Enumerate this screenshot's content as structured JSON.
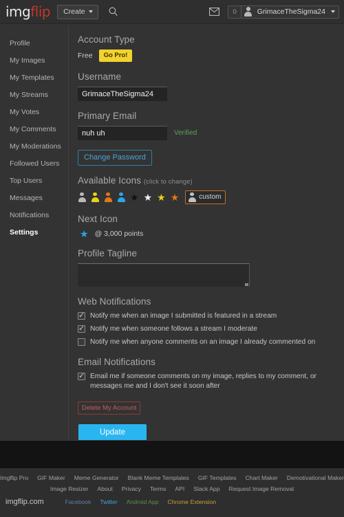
{
  "header": {
    "logo_img": "img",
    "logo_flip": "flip",
    "create_label": "Create",
    "search_icon": "search-icon",
    "mail_icon": "envelope-icon",
    "notification_count": "0",
    "username": "GrimaceTheSigma24"
  },
  "sidebar": {
    "items": [
      {
        "label": "Profile",
        "active": false
      },
      {
        "label": "My Images",
        "active": false
      },
      {
        "label": "My Templates",
        "active": false
      },
      {
        "label": "My Streams",
        "active": false
      },
      {
        "label": "My Votes",
        "active": false
      },
      {
        "label": "My Comments",
        "active": false
      },
      {
        "label": "My Moderations",
        "active": false
      },
      {
        "label": "Followed Users",
        "active": false
      },
      {
        "label": "Top Users",
        "active": false
      },
      {
        "label": "Messages",
        "active": false
      },
      {
        "label": "Notifications",
        "active": false
      },
      {
        "label": "Settings",
        "active": true
      }
    ]
  },
  "main": {
    "account_type": {
      "title": "Account Type",
      "plan": "Free",
      "go_pro_label": "Go Pro!"
    },
    "username": {
      "title": "Username",
      "value": "GrimaceTheSigma24"
    },
    "primary_email": {
      "title": "Primary Email",
      "value": "nuh uh",
      "status": "Verified"
    },
    "change_password_label": "Change Password",
    "available_icons": {
      "title": "Available Icons",
      "hint": "(click to change)",
      "icons": [
        {
          "type": "person",
          "color": "#b9b9b9",
          "name": "person-icon-gray"
        },
        {
          "type": "person",
          "color": "#e8d11a",
          "name": "person-icon-yellow"
        },
        {
          "type": "person",
          "color": "#e2761b",
          "name": "person-icon-orange"
        },
        {
          "type": "person",
          "color": "#2aa6e8",
          "name": "person-icon-blue"
        },
        {
          "type": "star",
          "color": "#111111",
          "name": "star-icon-black"
        },
        {
          "type": "star",
          "color": "#f2f2f2",
          "name": "star-icon-white"
        },
        {
          "type": "star",
          "color": "#e8d11a",
          "name": "star-icon-yellow"
        },
        {
          "type": "star",
          "color": "#e2761b",
          "name": "star-icon-orange"
        }
      ],
      "custom_label": "custom"
    },
    "next_icon": {
      "title": "Next Icon",
      "star_color": "#2aa6e8",
      "points_text": "@ 3,000 points"
    },
    "profile_tagline": {
      "title": "Profile Tagline",
      "value": "",
      "placeholder": ""
    },
    "web_notifications": {
      "title": "Web Notifications",
      "options": [
        {
          "label": "Notify me when an image I submitted is featured in a stream",
          "checked": true
        },
        {
          "label": "Notify me when someone follows a stream I moderate",
          "checked": true
        },
        {
          "label": "Notify me when anyone comments on an image I already commented on",
          "checked": false
        }
      ]
    },
    "email_notifications": {
      "title": "Email Notifications",
      "options": [
        {
          "label": "Email me if someone comments on my image, replies to my comment, or messages me and I don't see it soon after",
          "checked": true
        }
      ]
    },
    "delete_account_label": "Delete My Account",
    "update_label": "Update"
  },
  "footer": {
    "row1": [
      "Imgflip Pro",
      "GIF Maker",
      "Meme Generator",
      "Blank Meme Templates",
      "GIF Templates",
      "Chart Maker",
      "Demotivational Maker"
    ],
    "row2": [
      "Image Resizer",
      "About",
      "Privacy",
      "Terms",
      "API",
      "Slack App",
      "Request Image Removal"
    ],
    "site_name": "imgflip.com",
    "social": [
      {
        "label": "Facebook",
        "color": "#5f7fa8"
      },
      {
        "label": "Twitter",
        "color": "#3ea6dd"
      },
      {
        "label": "Android App",
        "color": "#5e8d4a"
      },
      {
        "label": "Chrome Extension",
        "color": "#c8a03a"
      }
    ]
  },
  "colors": {
    "accent_blue": "#29b6f0",
    "pro_yellow": "#f2d22e",
    "danger_red": "#c45b5b",
    "verified_green": "#5aa15a",
    "logo_red": "#c0392b",
    "custom_border_orange": "#c4702c"
  }
}
